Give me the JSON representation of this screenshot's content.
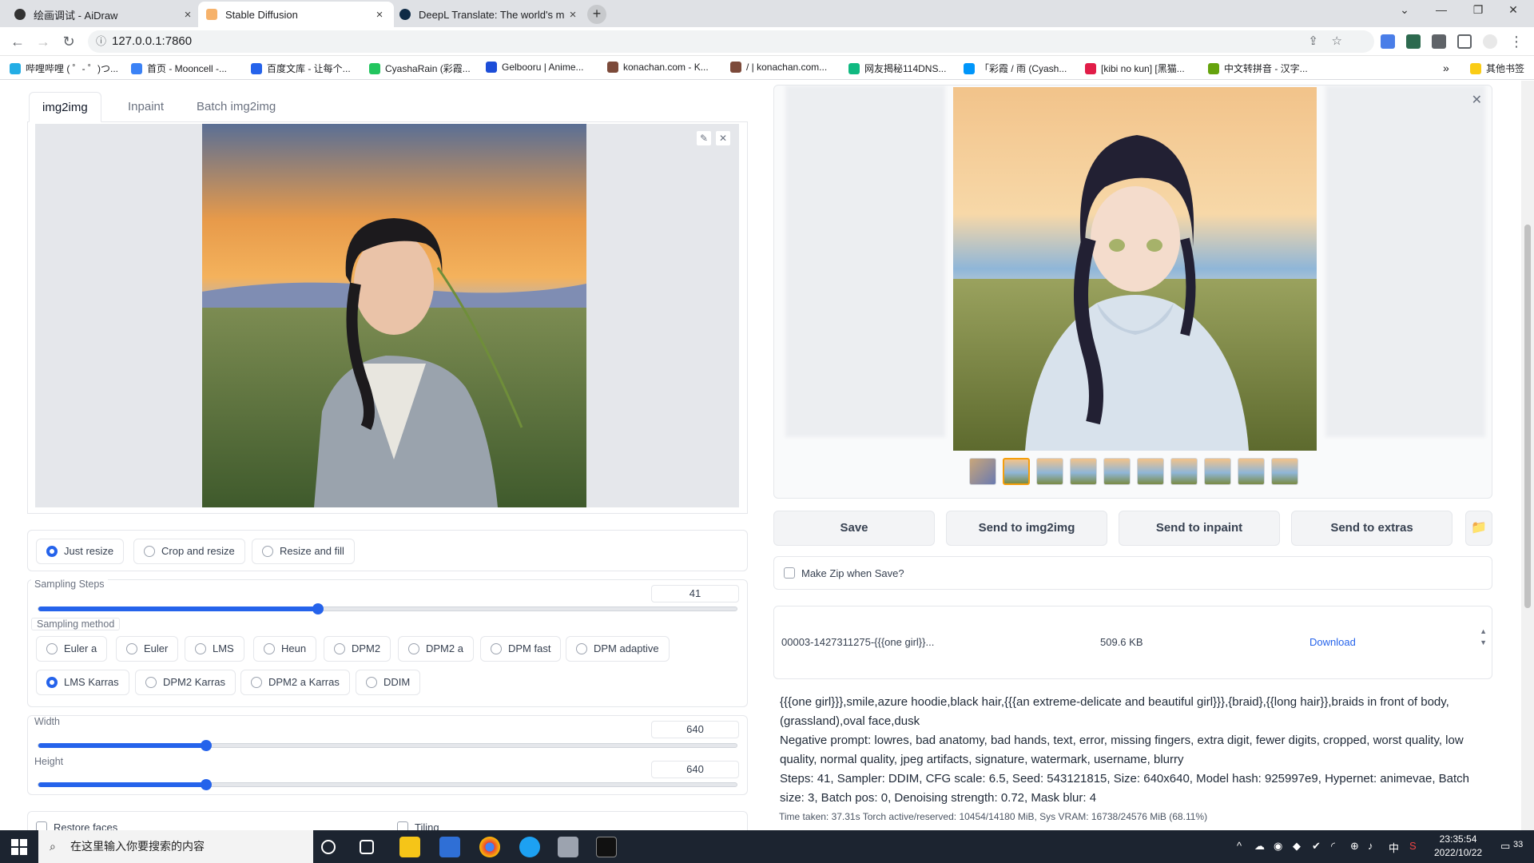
{
  "browser": {
    "tabs": [
      {
        "title": "绘画调试 - AiDraw",
        "close": "×"
      },
      {
        "title": "Stable Diffusion",
        "close": "×"
      },
      {
        "title": "DeepL Translate: The world's m",
        "close": "×"
      }
    ],
    "new_tab": "+",
    "url": "127.0.0.1:7860",
    "bookmarks": [
      "哔哩哔哩 ( ゜- ゜)つ...",
      "首页 - Mooncell -...",
      "百度文库 - 让每个...",
      "CyashaRain (彩霞...",
      "Gelbooru | Anime...",
      "konachan.com - K...",
      "/ | konachan.com...",
      "网友揭秘114DNS...",
      "「彩霞 / 雨 (Cyash...",
      "[kibi no kun] [黑猫...",
      "中文转拼音 - 汉字...",
      "其他书签"
    ],
    "bookmarks_more": "»"
  },
  "left": {
    "tabs": [
      "img2img",
      "Inpaint",
      "Batch img2img"
    ],
    "resize_options": [
      "Just resize",
      "Crop and resize",
      "Resize and fill"
    ],
    "sampling_steps": {
      "label": "Sampling Steps",
      "value": "41",
      "fraction": 0.4
    },
    "sampling_method": {
      "label": "Sampling method",
      "options_row1": [
        "Euler a",
        "Euler",
        "LMS",
        "Heun",
        "DPM2",
        "DPM2 a",
        "DPM fast",
        "DPM adaptive"
      ],
      "options_row2": [
        "LMS Karras",
        "DPM2 Karras",
        "DPM2 a Karras",
        "DDIM"
      ],
      "selected": "LMS Karras"
    },
    "width": {
      "label": "Width",
      "value": "640",
      "fraction": 0.24
    },
    "height": {
      "label": "Height",
      "value": "640",
      "fraction": 0.24
    },
    "restore_faces": "Restore faces",
    "tiling": "Tiling"
  },
  "right": {
    "buttons": [
      "Save",
      "Send to img2img",
      "Send to inpaint",
      "Send to extras"
    ],
    "folder_icon": "📁",
    "make_zip": "Make Zip when Save?",
    "file": {
      "name": "00003-1427311275-{{{one girl}}...",
      "size": "509.6 KB",
      "download": "Download"
    },
    "info_lines": [
      "{{{one girl}}},smile,azure hoodie,black hair,{{{an extreme-delicate and beautiful girl}}},{braid},{{long hair}},braids in front of body,(grassland),oval face,dusk",
      "Negative prompt: lowres, bad anatomy, bad hands, text, error, missing fingers, extra digit, fewer digits, cropped, worst quality, low quality, normal quality, jpeg artifacts, signature, watermark, username, blurry",
      "Steps: 41, Sampler: DDIM, CFG scale: 6.5, Seed: 543121815, Size: 640x640, Model hash: 925997e9, Hypernet: animevae, Batch size: 3, Batch pos: 0, Denoising strength: 0.72, Mask blur: 4"
    ],
    "timing": "Time taken: 37.31s  Torch active/reserved: 10454/14180 MiB, Sys VRAM: 16738/24576 MiB (68.11%)"
  },
  "taskbar": {
    "search_placeholder": "在这里输入你要搜索的内容",
    "ime": "中",
    "time": "23:35:54",
    "date": "2022/10/22",
    "notifications": "33"
  },
  "colors": {
    "accent": "#2563eb",
    "selected_thumb": "#f59e0b"
  }
}
